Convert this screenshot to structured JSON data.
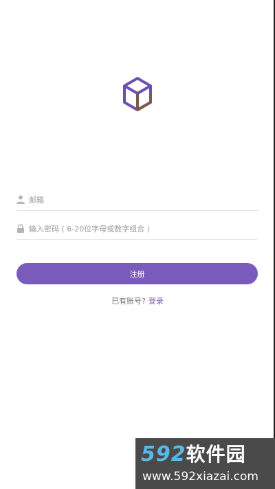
{
  "form": {
    "email_placeholder": "邮箱",
    "password_placeholder": "输入密码 ( 6-20位字母或数字组合 )",
    "register_label": "注册",
    "has_account_text": "已有账号?",
    "login_link": "登录"
  },
  "icons": {
    "app_logo": "hexagon-cube-icon",
    "email_field": "person-icon",
    "password_field": "lock-icon"
  },
  "watermark": {
    "logo_number": "592",
    "logo_text": "软件园",
    "url": "www.592xiazai.com"
  },
  "colors": {
    "accent": "#7a5bbb",
    "logo_purple": "#6b4fb3",
    "logo_brown": "#7a5a4a",
    "watermark_blue": "#58b9e6",
    "watermark_bg": "#4a4a4a"
  }
}
